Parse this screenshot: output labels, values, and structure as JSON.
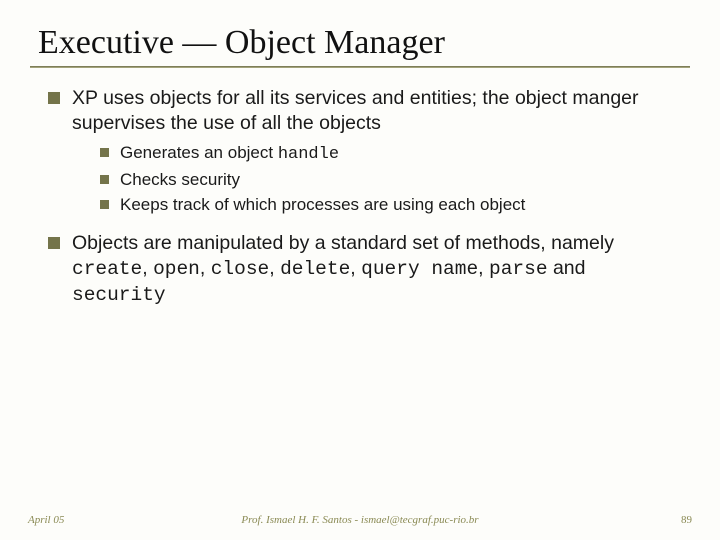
{
  "title": "Executive — Object Manager",
  "bullets": [
    {
      "text_a": "XP uses objects for all its services and entities; the object manger supervises the use of all the objects",
      "sub": [
        {
          "t1": "Generates an object ",
          "code1": "handle"
        },
        {
          "t1": "Checks security"
        },
        {
          "t1": "Keeps track of which processes are using each object"
        }
      ]
    },
    {
      "text_a": "Objects are manipulated by a standard set of methods, namely ",
      "code1": "create",
      "sep1": ", ",
      "code2": "open",
      "sep2": ", ",
      "code3": "close",
      "sep3": ", ",
      "code4": "delete",
      "sep4": ", ",
      "code5": "query name",
      "sep5": ", ",
      "code6": "parse",
      "sep6": " and ",
      "code7": "security"
    }
  ],
  "footer": {
    "left": "April 05",
    "center": "Prof. Ismael H. F. Santos  -  ismael@tecgraf.puc-rio.br",
    "right": "89"
  }
}
